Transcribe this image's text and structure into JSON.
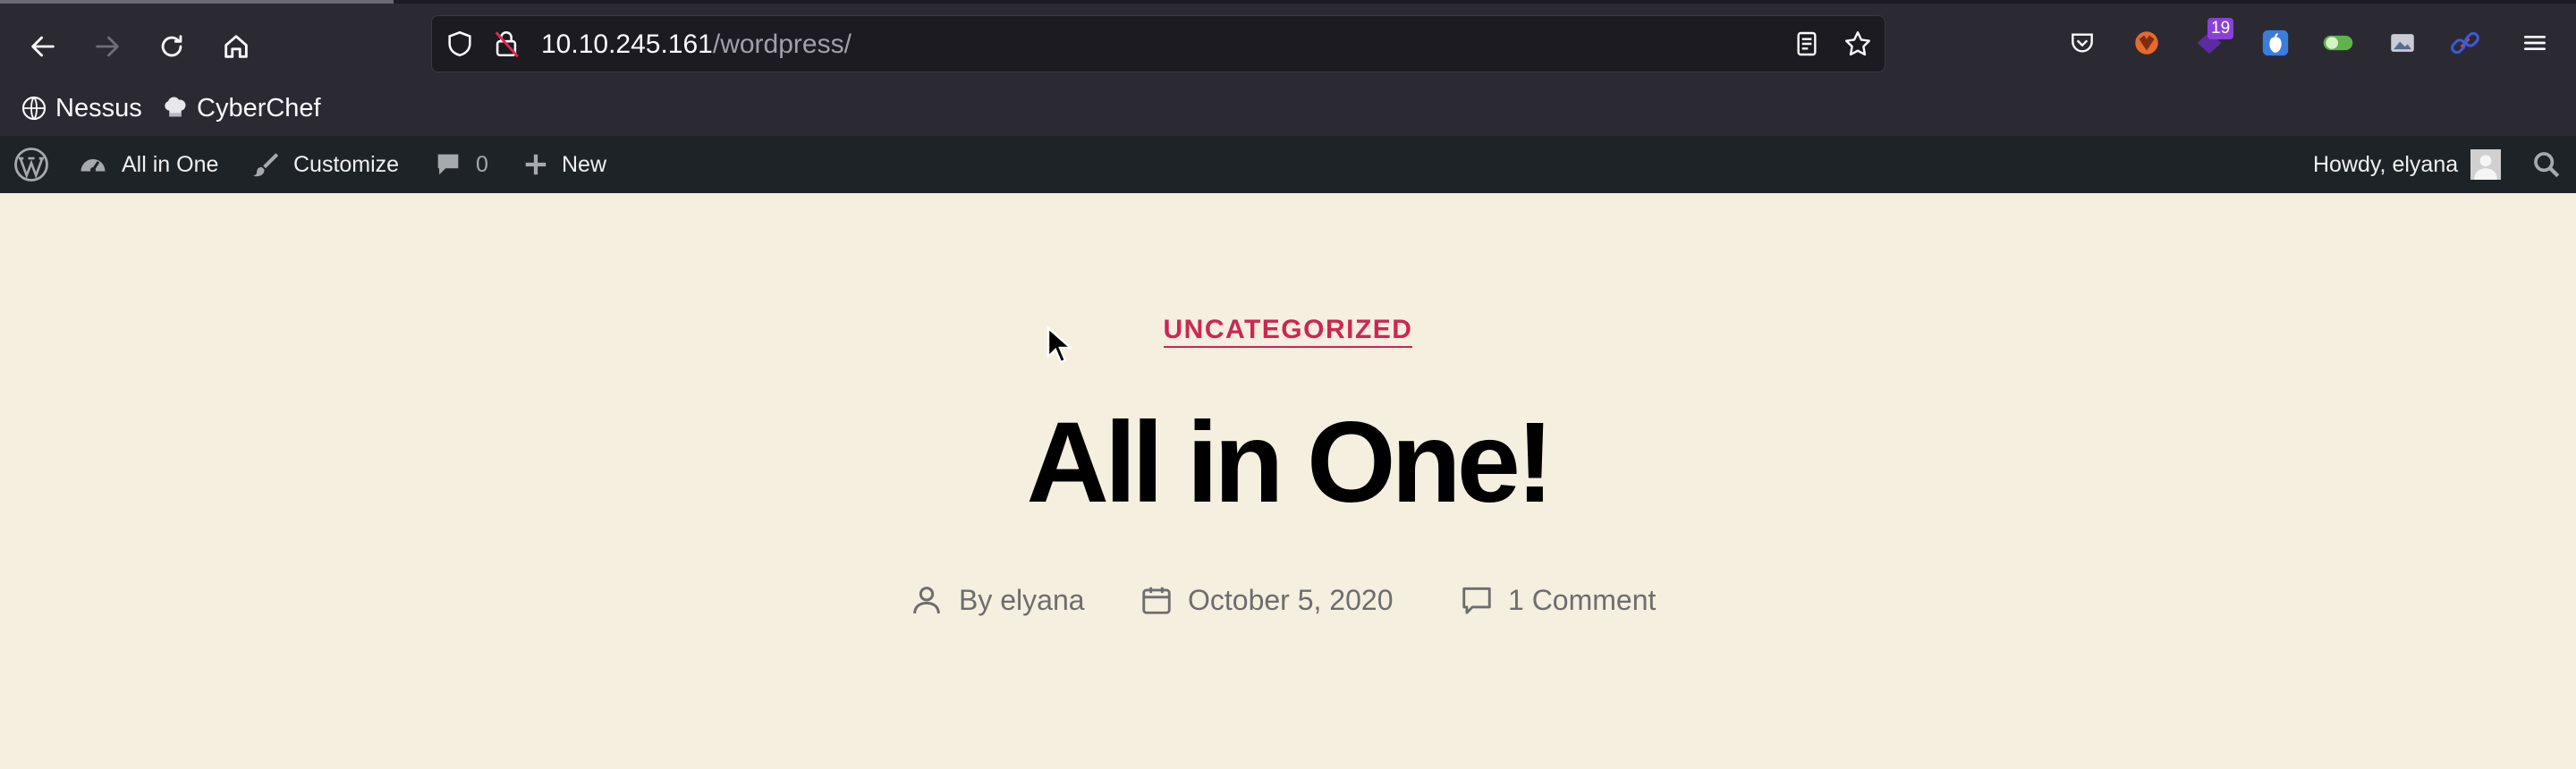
{
  "browser": {
    "url_host": "10.10.245.161",
    "url_path": "/wordpress/",
    "extension_badge": "19",
    "bookmarks": [
      {
        "label": "Nessus",
        "icon": "globe-icon"
      },
      {
        "label": "CyberChef",
        "icon": "chef-hat-icon"
      }
    ]
  },
  "admin_bar": {
    "site_name": "All in One",
    "customize": "Customize",
    "comments_count": "0",
    "new_label": "New",
    "howdy": "Howdy, elyana"
  },
  "post": {
    "category": "UNCATEGORIZED",
    "title": "All in One!",
    "author": "By elyana",
    "date": "October 5, 2020",
    "comments": "1 Comment"
  },
  "colors": {
    "accent": "#cd2653",
    "page_bg": "#f5efe0",
    "admin_bar_bg": "#1d2327",
    "browser_bg": "#2b2a33"
  }
}
